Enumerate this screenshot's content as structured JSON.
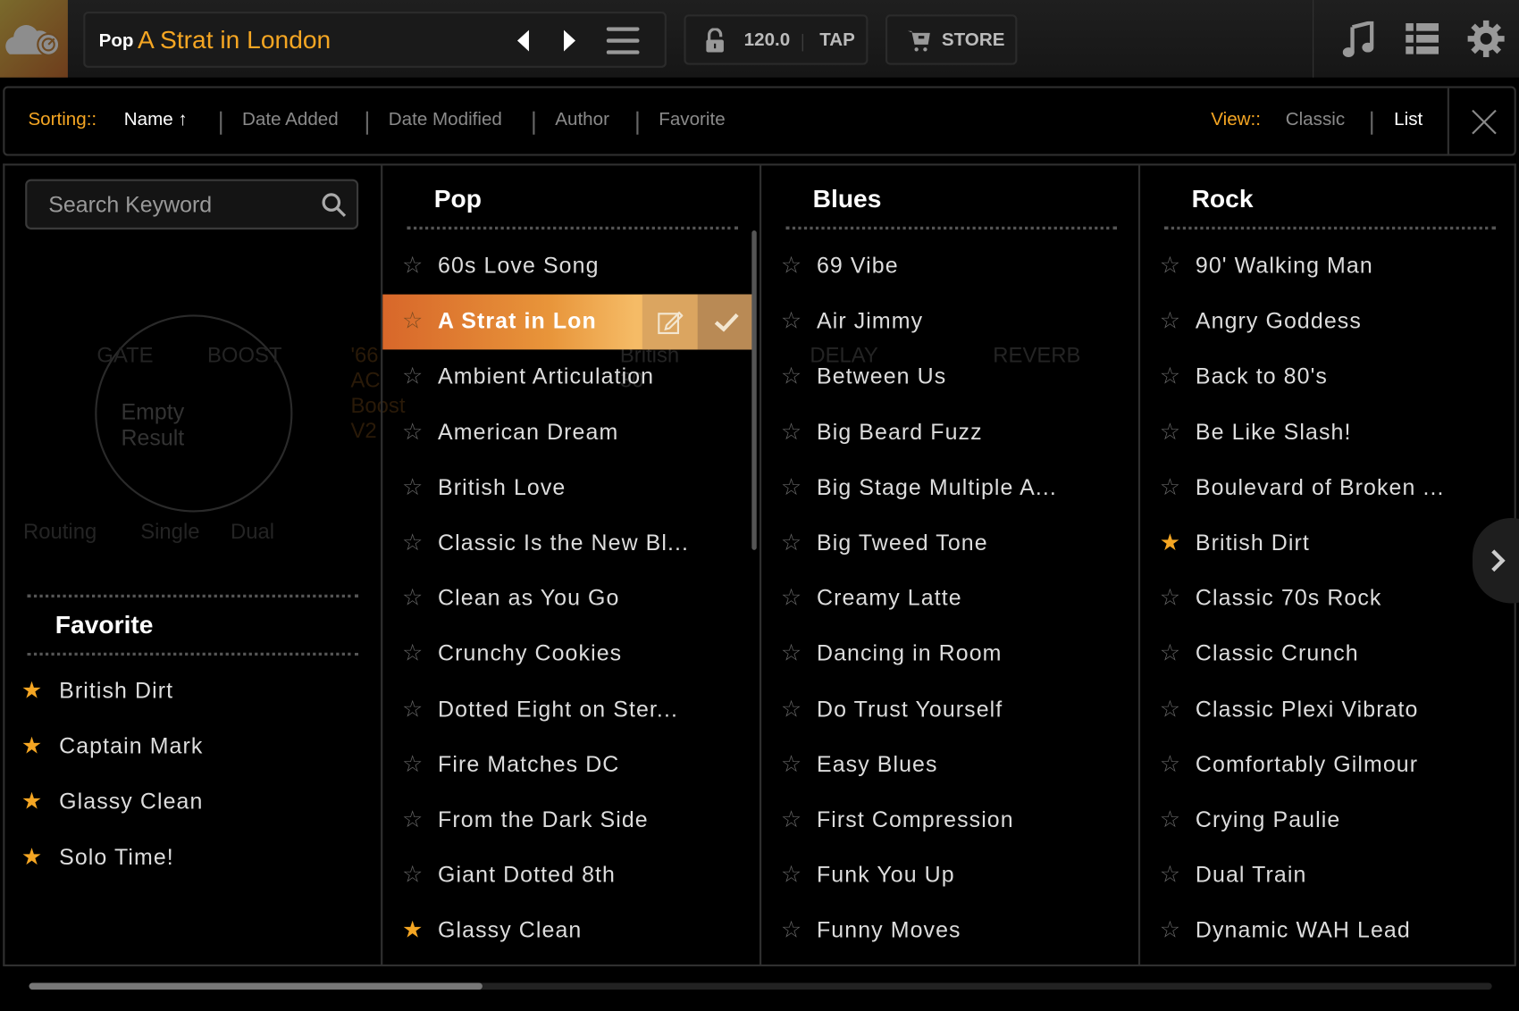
{
  "topbar": {
    "preset_category": "Pop",
    "preset_name": "A Strat in London",
    "tempo": "120.0",
    "tap_label": "TAP",
    "store_label": "STORE",
    "icons": [
      "cloud-icon",
      "chevron-left-icon",
      "chevron-right-icon",
      "menu-icon",
      "lock-icon",
      "cart-icon",
      "music-note-icon",
      "list-icon",
      "gear-icon"
    ]
  },
  "sorting": {
    "label": "Sorting::",
    "options": [
      "Name",
      "Date Added",
      "Date Modified",
      "Author",
      "Favorite"
    ],
    "active": "Name",
    "direction": "ascending"
  },
  "view": {
    "label": "View::",
    "options": [
      "Classic",
      "List"
    ],
    "active": "List"
  },
  "search": {
    "placeholder": "Search Keyword"
  },
  "background": {
    "empty_result": "Empty Result",
    "ghost_labels": [
      "GATE",
      "BOOST",
      "'66 AC Boost V2",
      "British 30",
      "DELAY",
      "REVERB",
      "Routing",
      "Single",
      "Dual"
    ]
  },
  "favorites": {
    "title": "Favorite",
    "items": [
      "British Dirt",
      "Captain Mark",
      "Glassy Clean",
      "Solo Time!"
    ]
  },
  "colors": {
    "accent": "#f5a623",
    "background": "#000000"
  },
  "columns": [
    {
      "title": "Pop",
      "selected": 1,
      "items": [
        {
          "name": "60s Love Song",
          "fav": false
        },
        {
          "name": "A Strat in Lon",
          "fav": false
        },
        {
          "name": "Ambient Articulation",
          "fav": false
        },
        {
          "name": "American Dream",
          "fav": false
        },
        {
          "name": "British Love",
          "fav": false
        },
        {
          "name": "Classic Is the New Bl...",
          "fav": false
        },
        {
          "name": "Clean as You Go",
          "fav": false
        },
        {
          "name": "Crunchy Cookies",
          "fav": false
        },
        {
          "name": "Dotted Eight on Ster...",
          "fav": false
        },
        {
          "name": "Fire Matches DC",
          "fav": false
        },
        {
          "name": "From the Dark Side",
          "fav": false
        },
        {
          "name": "Giant Dotted 8th",
          "fav": false
        },
        {
          "name": "Glassy Clean",
          "fav": true
        }
      ]
    },
    {
      "title": "Blues",
      "selected": -1,
      "items": [
        {
          "name": "69 Vibe",
          "fav": false
        },
        {
          "name": "Air Jimmy",
          "fav": false
        },
        {
          "name": "Between Us",
          "fav": false
        },
        {
          "name": "Big Beard Fuzz",
          "fav": false
        },
        {
          "name": "Big Stage Multiple A...",
          "fav": false
        },
        {
          "name": "Big Tweed Tone",
          "fav": false
        },
        {
          "name": "Creamy Latte",
          "fav": false
        },
        {
          "name": "Dancing in Room",
          "fav": false
        },
        {
          "name": "Do Trust Yourself",
          "fav": false
        },
        {
          "name": "Easy Blues",
          "fav": false
        },
        {
          "name": "First Compression",
          "fav": false
        },
        {
          "name": "Funk You Up",
          "fav": false
        },
        {
          "name": "Funny Moves",
          "fav": false
        }
      ]
    },
    {
      "title": "Rock",
      "selected": -1,
      "items": [
        {
          "name": "90' Walking Man",
          "fav": false
        },
        {
          "name": "Angry Goddess",
          "fav": false
        },
        {
          "name": "Back to 80's",
          "fav": false
        },
        {
          "name": "Be Like Slash!",
          "fav": false
        },
        {
          "name": "Boulevard of Broken ...",
          "fav": false
        },
        {
          "name": "British Dirt",
          "fav": true
        },
        {
          "name": "Classic 70s Rock",
          "fav": false
        },
        {
          "name": "Classic Crunch",
          "fav": false
        },
        {
          "name": "Classic Plexi Vibrato",
          "fav": false
        },
        {
          "name": "Comfortably Gilmour",
          "fav": false
        },
        {
          "name": "Crying Paulie",
          "fav": false
        },
        {
          "name": "Dual Train",
          "fav": false
        },
        {
          "name": "Dynamic WAH Lead",
          "fav": false
        }
      ]
    }
  ],
  "scroll": {
    "horizontal_position": 0.31
  }
}
